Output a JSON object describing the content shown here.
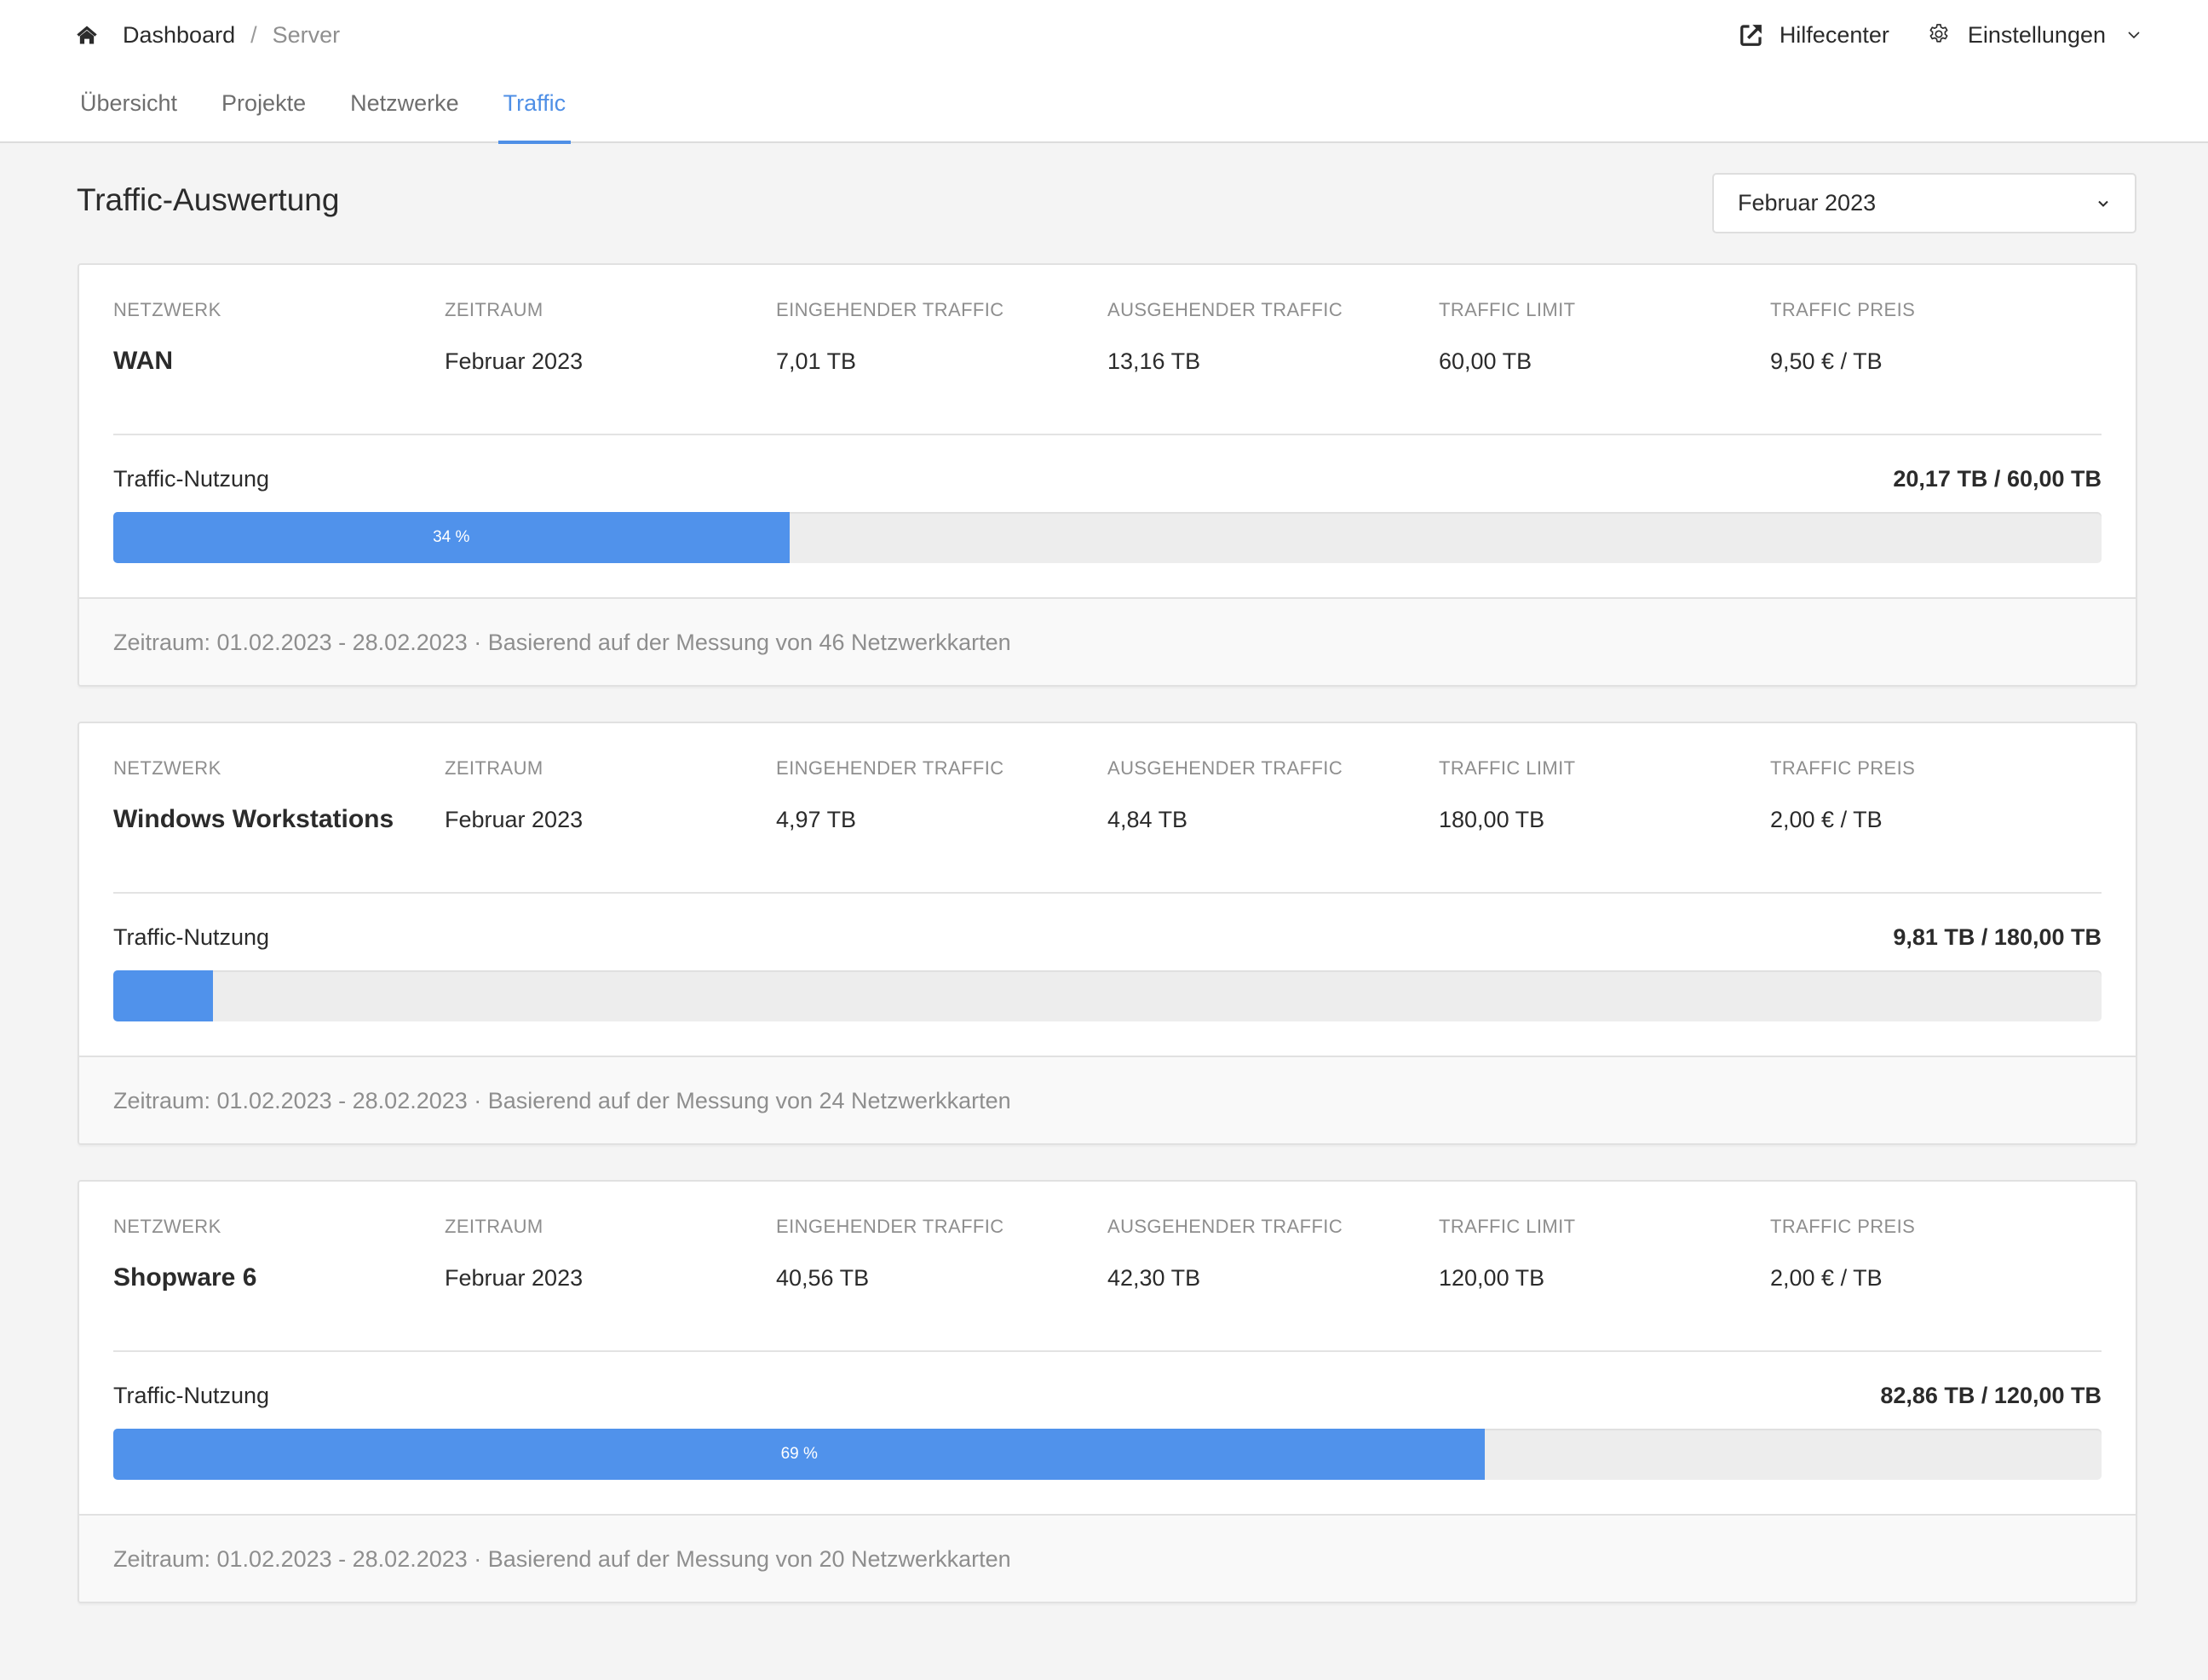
{
  "breadcrumb": {
    "home_icon": "home-icon",
    "items": [
      "Dashboard",
      "Server"
    ],
    "separator": "/"
  },
  "top_actions": {
    "help": {
      "icon": "external-link-icon",
      "label": "Hilfecenter"
    },
    "settings": {
      "icon": "gear-icon",
      "label": "Einstellungen",
      "chevron": "chevron-down-icon"
    }
  },
  "tabs": [
    {
      "label": "Übersicht",
      "active": false
    },
    {
      "label": "Projekte",
      "active": false
    },
    {
      "label": "Netzwerke",
      "active": false
    },
    {
      "label": "Traffic",
      "active": true
    }
  ],
  "page": {
    "title": "Traffic-Auswertung",
    "month_select": {
      "value": "Februar 2023",
      "icon": "chevron-down-icon"
    }
  },
  "columns": [
    "Netzwerk",
    "Zeitraum",
    "Eingehender Traffic",
    "Ausgehender Traffic",
    "Traffic Limit",
    "Traffic Preis"
  ],
  "usage_label": "Traffic-Nutzung",
  "colors": {
    "accent": "#4f8fe6",
    "bar_fill": "#5092eb",
    "bar_track": "#ededed"
  },
  "cards": [
    {
      "network": "WAN",
      "period": "Februar 2023",
      "incoming": "7,01 TB",
      "outgoing": "13,16 TB",
      "limit": "60,00 TB",
      "price": "9,50 € / TB",
      "usage_text": "20,17 TB / 60,00 TB",
      "usage_percent": 34,
      "usage_percent_label": "34 %",
      "footer": "Zeitraum: 01.02.2023 - 28.02.2023 · Basierend auf der Messung von 46 Netzwerkkarten"
    },
    {
      "network": "Windows Workstations",
      "period": "Februar 2023",
      "incoming": "4,97 TB",
      "outgoing": "4,84 TB",
      "limit": "180,00 TB",
      "price": "2,00 € / TB",
      "usage_text": "9,81 TB / 180,00 TB",
      "usage_percent": 5,
      "usage_percent_label": "",
      "footer": "Zeitraum: 01.02.2023 - 28.02.2023 · Basierend auf der Messung von 24 Netzwerkkarten"
    },
    {
      "network": "Shopware 6",
      "period": "Februar 2023",
      "incoming": "40,56 TB",
      "outgoing": "42,30 TB",
      "limit": "120,00 TB",
      "price": "2,00 € / TB",
      "usage_text": "82,86 TB / 120,00 TB",
      "usage_percent": 69,
      "usage_percent_label": "69 %",
      "footer": "Zeitraum: 01.02.2023 - 28.02.2023 · Basierend auf der Messung von 20 Netzwerkkarten"
    }
  ]
}
